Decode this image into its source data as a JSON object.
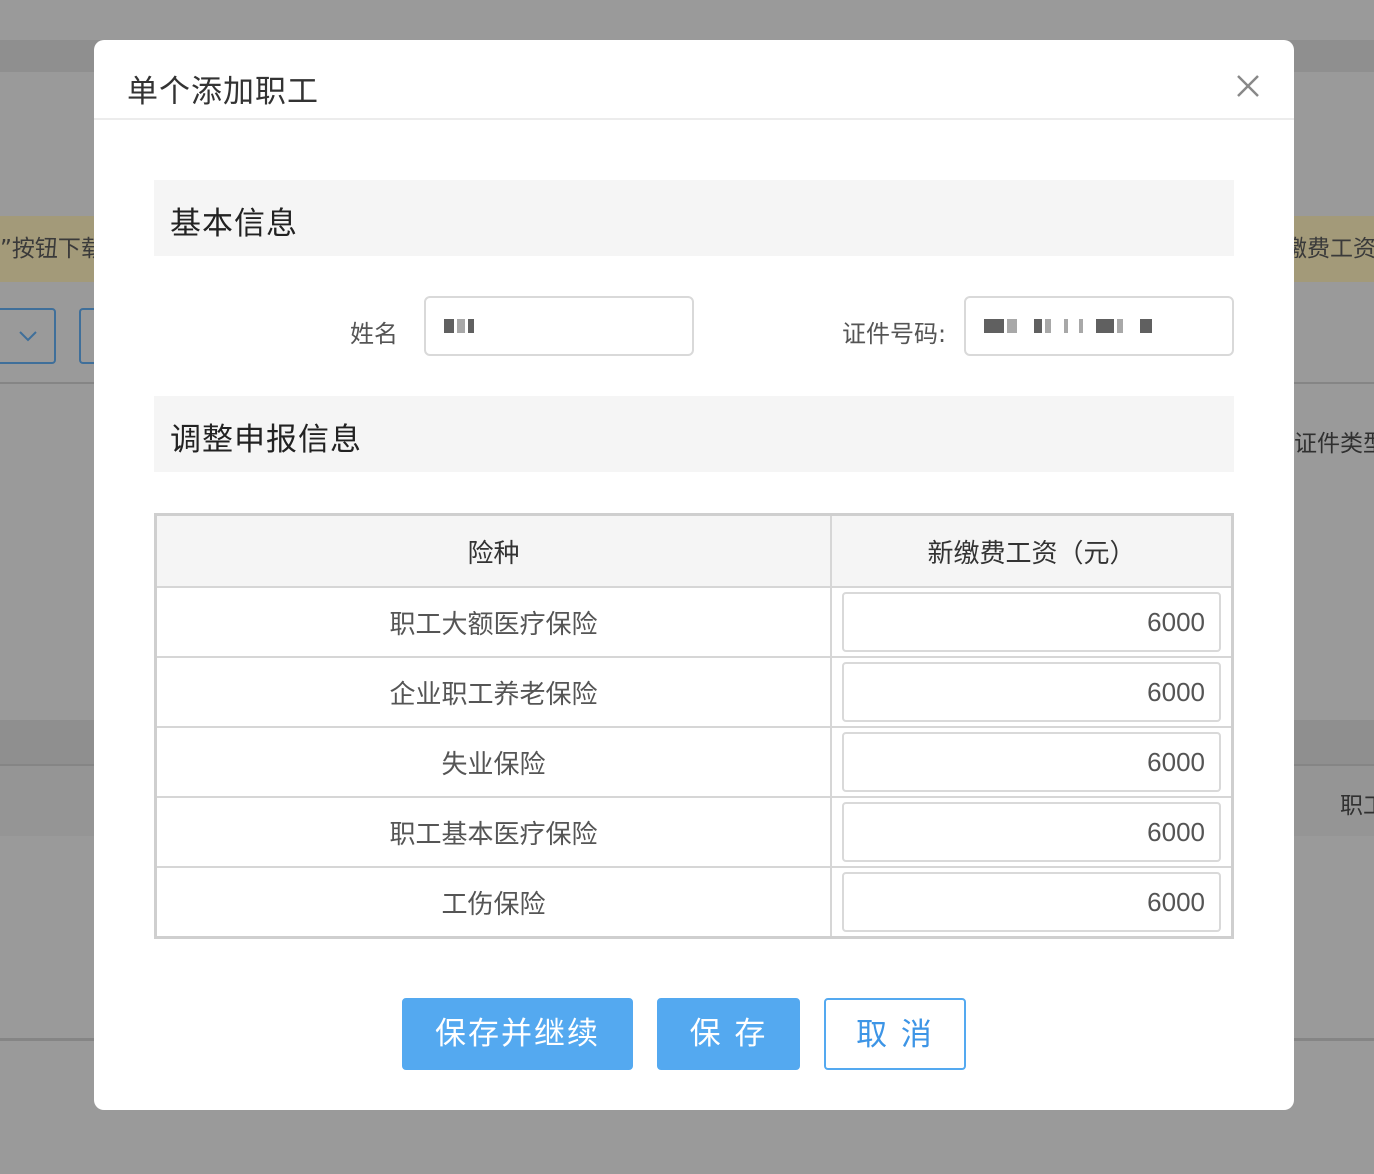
{
  "background": {
    "notice_left": "”按钮下载",
    "notice_right": "缴费工资",
    "right_label": "证件类型",
    "right_column": "职工"
  },
  "modal": {
    "title": "单个添加职工",
    "close_icon": "close-icon",
    "basic_section": "基本信息",
    "name_label": "姓名",
    "id_label": "证件号码:",
    "adjust_section": "调整申报信息"
  },
  "table": {
    "headers": [
      "险种",
      "新缴费工资（元）"
    ],
    "rows": [
      {
        "type": "职工大额医疗保险",
        "amount": "6000"
      },
      {
        "type": "企业职工养老保险",
        "amount": "6000"
      },
      {
        "type": "失业保险",
        "amount": "6000"
      },
      {
        "type": "职工基本医疗保险",
        "amount": "6000"
      },
      {
        "type": "工伤保险",
        "amount": "6000"
      }
    ]
  },
  "buttons": {
    "save_continue": "保存并继续",
    "save": "保 存",
    "cancel": "取 消"
  },
  "colors": {
    "primary": "#54a9f0",
    "overlay": "#9a9a9a",
    "section_bg": "#f5f5f5"
  }
}
